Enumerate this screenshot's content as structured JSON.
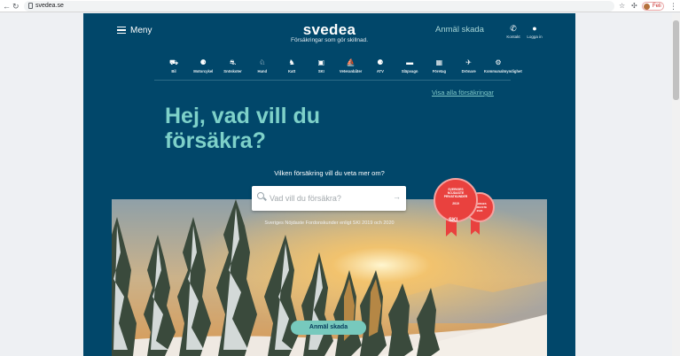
{
  "browser": {
    "url": "svedea.se",
    "profile_name": "Feli",
    "back_icon": "arrow-left-icon",
    "refresh_icon": "refresh-icon"
  },
  "header": {
    "menu_label": "Meny",
    "logo_text": "svedea",
    "tagline": "Försäkringar som gör skillnad.",
    "report_damage": "Anmäl skada",
    "contact_label": "Kontakt",
    "login_label": "Logga in"
  },
  "categories": [
    {
      "label": "Bil",
      "icon": "car-icon"
    },
    {
      "label": "Motorcykel",
      "icon": "motorcycle-icon"
    },
    {
      "label": "Snöskoter",
      "icon": "snowmobile-icon"
    },
    {
      "label": "Hund",
      "icon": "dog-icon"
    },
    {
      "label": "Katt",
      "icon": "cat-icon"
    },
    {
      "label": "SKI",
      "icon": "ski-icon"
    },
    {
      "label": "Veteranbåter",
      "icon": "boat-icon"
    },
    {
      "label": "ATV",
      "icon": "atv-icon"
    },
    {
      "label": "Släpvagn",
      "icon": "trailer-icon"
    },
    {
      "label": "Företag",
      "icon": "building-icon"
    },
    {
      "label": "Drönare",
      "icon": "drone-icon"
    },
    {
      "label": "Kommunalmyndighet",
      "icon": "municipal-icon"
    }
  ],
  "all_insurances_link": "Visa alla försäkringar",
  "headline": "Hej, vad vill du försäkra?",
  "question": "Vilken försäkring vill du veta mer om?",
  "search": {
    "placeholder": "Vad vill du försäkra?"
  },
  "survey_note": "Sveriges Nöjdaste Fordonskunder enligt SKI 2019 och 2020",
  "badge": {
    "line1": "SVERIGES",
    "line2": "NÖJDASTE",
    "line3": "PRIVATKUNDER",
    "year1": "2019",
    "year2": "2020",
    "brand": "SKI"
  },
  "cta_label": "Anmäl skada",
  "colors": {
    "brand_bg": "#01476a",
    "accent": "#7ed1c9",
    "badge_red": "#e9413e"
  }
}
